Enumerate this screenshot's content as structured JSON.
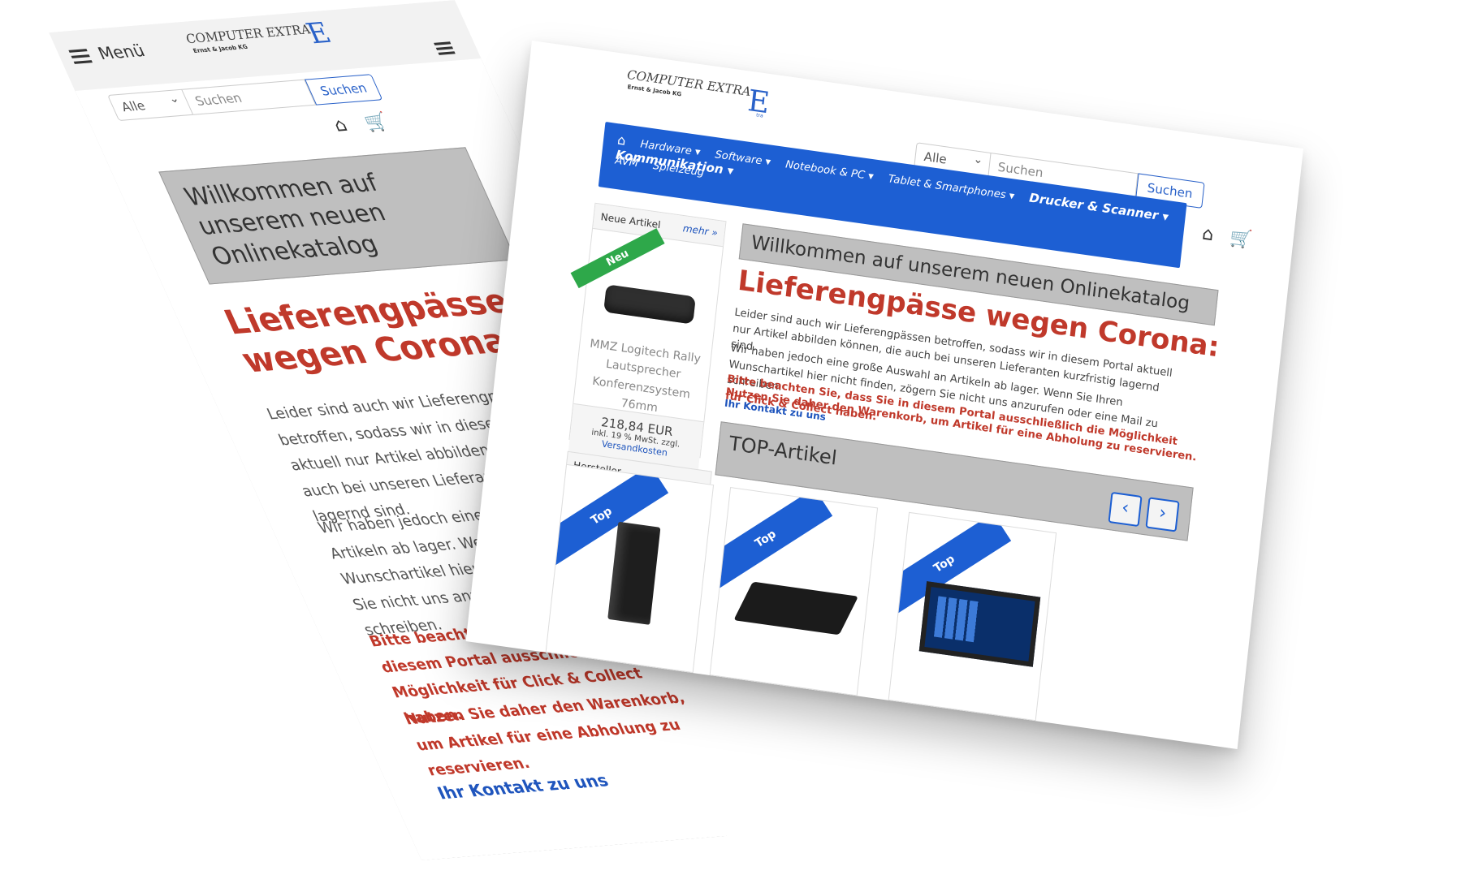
{
  "brand": {
    "name": "COMPUTER EXTRA",
    "subtitle": "Ernst & Jacob KG",
    "letter": "E",
    "mark_text": "tra"
  },
  "search": {
    "category_value": "Alle",
    "placeholder": "Suchen",
    "button_label": "Suchen"
  },
  "mobile": {
    "menu_label": "Menü",
    "welcome_title": "Willkommen auf unserem neuen Onlinekatalog",
    "headline": "Lieferengpässe wegen Corona:",
    "paragraph1": "Leider sind auch wir Lieferengpässen betroffen, sodass wir in diesem Portal aktuell nur Artikel abbilden können, die auch bei unseren Lieferanten kurzfristig lagernd sind.",
    "paragraph2": "Wir haben jedoch eine große Auswahl an Artikeln ab lager. Wenn Sie Ihren Wunschartikel hier nicht finden, zögern Sie nicht uns anzurufen oder eine Mail zu schreiben.",
    "notice1": "Bitte beachten Sie, dass Sie in diesem Portal ausschließlich die Möglichkeit für Click & Collect haben.",
    "notice2": "Nutzen Sie daher den Warenkorb, um Artikel für eine Abholung zu reservieren.",
    "contact_link": "Ihr Kontakt zu uns"
  },
  "desktop": {
    "nav": {
      "items": [
        "Hardware",
        "Software",
        "Notebook & PC",
        "Tablet & Smartphones",
        "Drucker & Scanner",
        "Kommunikation"
      ],
      "items_row2": [
        "AVM",
        "Spielzeug"
      ]
    },
    "sidebar": {
      "heading": "Neue Artikel",
      "more_link": "mehr »",
      "badge": "Neu",
      "product_name": "MMZ Logitech Rally Lautsprecher Konferenzsystem 76mm",
      "price": "218,84 EUR",
      "tax_note": "inkl. 19 % MwSt. zzgl.",
      "shipping_link": "Versandkosten",
      "manufacturer_heading": "Hersteller"
    },
    "welcome_title": "Willkommen auf unserem neuen Onlinekatalog",
    "headline": "Lieferengpässe wegen Corona:",
    "paragraph1": "Leider sind auch wir Lieferengpässen betroffen, sodass wir in diesem Portal aktuell nur Artikel abbilden können, die auch bei unseren Lieferanten kurzfristig lagernd sind.",
    "paragraph2": "Wir haben jedoch eine große Auswahl an Artikeln ab lager. Wenn Sie Ihren Wunschartikel hier nicht finden, zögern Sie nicht uns anzurufen oder eine Mail zu schreiben.",
    "notice1": "Bitte beachten Sie, dass Sie in diesem Portal ausschließlich die Möglichkeit für Click & Collect haben.",
    "notice2": "Nutzen Sie daher den Warenkorb, um Artikel für eine Abholung zu reservieren.",
    "contact_link": "Ihr Kontakt zu uns",
    "top_section_title": "TOP-Artikel",
    "top_badge": "Top",
    "carousel": {
      "prev_icon": "chevron-left-icon",
      "next_icon": "chevron-right-icon"
    }
  },
  "icons": {
    "home": "home-icon",
    "cart": "cart-icon",
    "menu": "hamburger-icon"
  },
  "colors": {
    "accent_blue": "#1d5fd3",
    "alert_red": "#c0392b",
    "new_green": "#2ea84a",
    "panel_gray": "#bfbfbf"
  }
}
